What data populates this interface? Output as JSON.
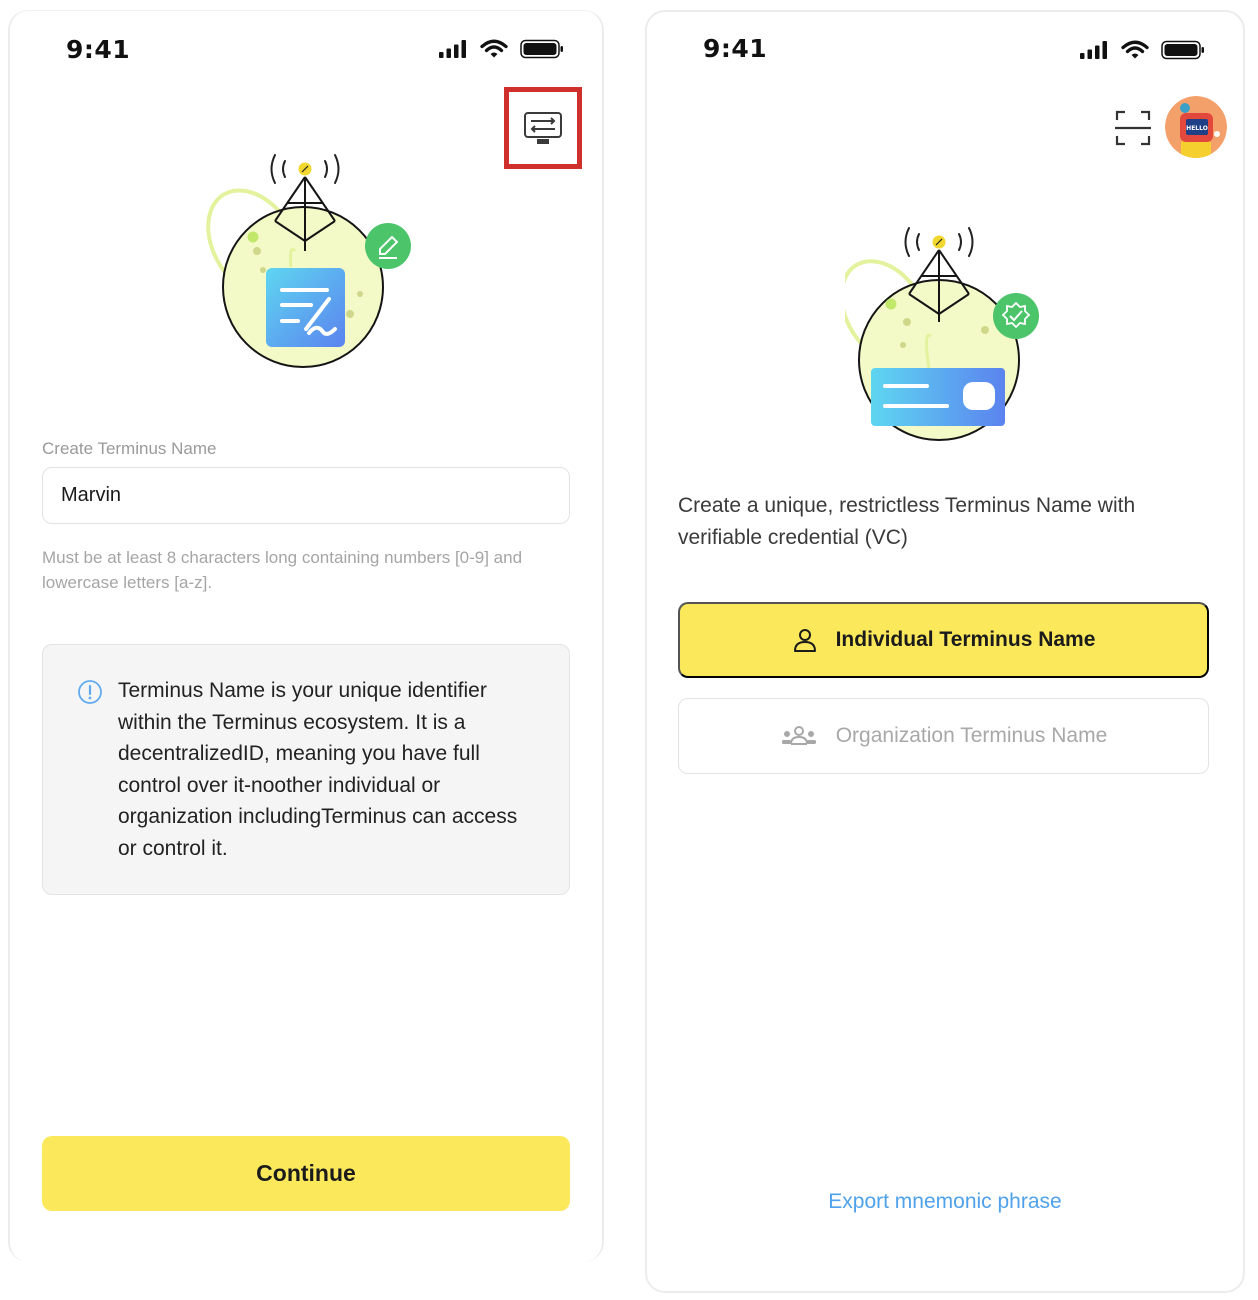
{
  "left_screen": {
    "status_time": "9:41",
    "field_label": "Create Terminus Name",
    "name_input_value": "Marvin",
    "hint": "Must be at least 8 characters long containing numbers [0-9] and lowercase letters [a-z].",
    "info_text": "Terminus Name is your unique identifier within the Terminus ecosystem. It is a decentralizedID, meaning you have full control over it-noother individual or organization includingTerminus can access or control it.",
    "continue_label": "Continue"
  },
  "right_screen": {
    "status_time": "9:41",
    "avatar_badge": "HELLO",
    "description": "Create a unique, restrictless Terminus Name with verifiable credential (VC)",
    "individual_label": "Individual Terminus Name",
    "organization_label": "Organization Terminus Name",
    "export_label": "Export mnemonic phrase"
  },
  "colors": {
    "accent_yellow": "#fce95b",
    "highlight_red": "#d0302c",
    "link_blue": "#4fa2ea",
    "badge_green": "#4cc46a",
    "info_blue": "#62aaf0"
  }
}
